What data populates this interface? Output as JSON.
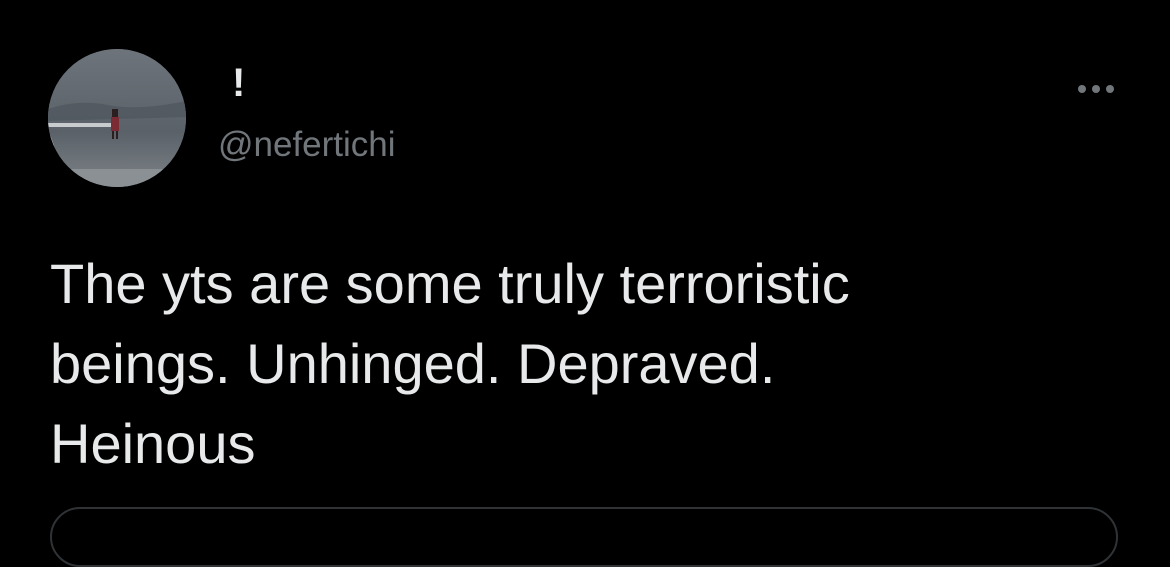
{
  "tweet": {
    "author": {
      "display_name": "!",
      "handle": "@nefertichi",
      "avatar_icon": "avatar-photo"
    },
    "menu_icon": "more-horizontal-icon",
    "text": "The yts are some truly terroristic\nbeings. Unhinged. Depraved.\nHeinous"
  },
  "colors": {
    "background": "#000000",
    "text_primary": "#e7e9ea",
    "text_secondary": "#71767b",
    "border": "#2f3336"
  }
}
